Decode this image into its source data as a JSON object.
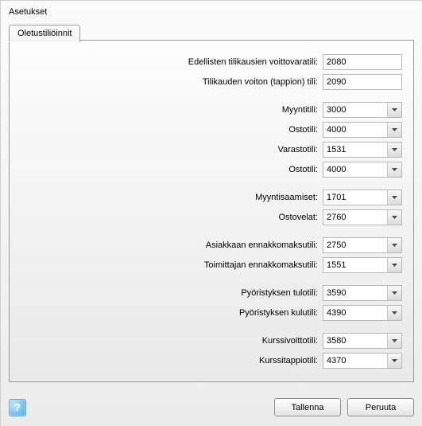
{
  "window_title": "Asetukset",
  "tab_label": "Oletustiliöinnit",
  "rows": {
    "prev_profit": {
      "label": "Edellisten tilikausien voittovaratili:",
      "value": "2080"
    },
    "period_profit": {
      "label": "Tilikauden voiton (tappion) tili:",
      "value": "2090"
    },
    "sales": {
      "label": "Myyntitili:",
      "value": "3000"
    },
    "purchase": {
      "label": "Ostotili:",
      "value": "4000"
    },
    "inventory": {
      "label": "Varastotili:",
      "value": "1531"
    },
    "purchase2": {
      "label": "Ostotili:",
      "value": "4000"
    },
    "receivables": {
      "label": "Myyntisaamiset:",
      "value": "1701"
    },
    "payables": {
      "label": "Ostovelat:",
      "value": "2760"
    },
    "cust_advance": {
      "label": "Asiakkaan ennakkomaksutili:",
      "value": "2750"
    },
    "supp_advance": {
      "label": "Toimittajan ennakkomaksutili:",
      "value": "1551"
    },
    "rounding_income": {
      "label": "Pyöristyksen tulotili:",
      "value": "3590"
    },
    "rounding_expense": {
      "label": "Pyöristyksen kulutili:",
      "value": "4390"
    },
    "fx_gain": {
      "label": "Kurssivoittotili:",
      "value": "3580"
    },
    "fx_loss": {
      "label": "Kurssitappiotili:",
      "value": "4370"
    }
  },
  "buttons": {
    "save": "Tallenna",
    "cancel": "Peruuta"
  },
  "help_symbol": "?"
}
